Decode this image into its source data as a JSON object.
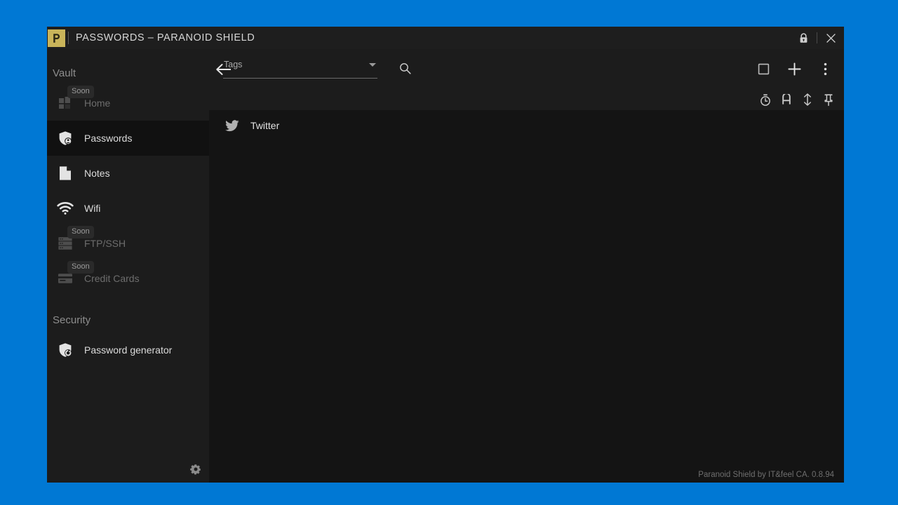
{
  "window": {
    "title": "PASSWORDS – PARANOID SHIELD",
    "logo_letter": "P",
    "logo_color": "#c9b45a",
    "lock_icon": "lock-icon",
    "close_icon": "close-icon"
  },
  "sidebar": {
    "sections": [
      {
        "title": "Vault",
        "items": [
          {
            "label": "Home",
            "icon": "dashboard-icon",
            "badge": "Soon",
            "active": false,
            "disabled": true
          },
          {
            "label": "Passwords",
            "icon": "shield-user-icon",
            "badge": "",
            "active": true,
            "disabled": false
          },
          {
            "label": "Notes",
            "icon": "note-icon",
            "badge": "",
            "active": false,
            "disabled": false
          },
          {
            "label": "Wifi",
            "icon": "wifi-icon",
            "badge": "",
            "active": false,
            "disabled": false
          },
          {
            "label": "FTP/SSH",
            "icon": "server-icon",
            "badge": "Soon",
            "active": false,
            "disabled": true
          },
          {
            "label": "Credit Cards",
            "icon": "credit-card-icon",
            "badge": "Soon",
            "active": false,
            "disabled": true
          }
        ]
      },
      {
        "title": "Security",
        "items": [
          {
            "label": "Password generator",
            "icon": "shield-refresh-icon",
            "badge": "",
            "active": false,
            "disabled": false
          }
        ]
      }
    ],
    "settings_icon": "gear-icon"
  },
  "toolbar": {
    "back_icon": "arrow-left-icon",
    "tags_label": "Tags",
    "tags_value": "",
    "search_icon": "search-icon",
    "actions": [
      {
        "name": "select-mode-button",
        "icon": "square-icon"
      },
      {
        "name": "add-entry-button",
        "icon": "plus-icon"
      },
      {
        "name": "overflow-menu-button",
        "icon": "more-vertical-icon"
      }
    ]
  },
  "sortbar": {
    "buttons": [
      {
        "name": "sort-by-recent-button",
        "icon": "timer-icon"
      },
      {
        "name": "sort-alphabetical-button",
        "icon": "letter-a-icon"
      },
      {
        "name": "sort-direction-button",
        "icon": "updown-arrows-icon"
      },
      {
        "name": "pin-filter-button",
        "icon": "pin-icon"
      }
    ]
  },
  "list": {
    "items": [
      {
        "label": "Twitter",
        "icon": "twitter-icon"
      }
    ]
  },
  "footer": {
    "text": "Paranoid Shield by IT&feel CA. 0.8.94"
  },
  "colors": {
    "desktop": "#0078d4",
    "window_bg": "#1c1c1c",
    "content_bg": "#141414",
    "active_item": "#111111",
    "accent": "#c9b45a"
  }
}
